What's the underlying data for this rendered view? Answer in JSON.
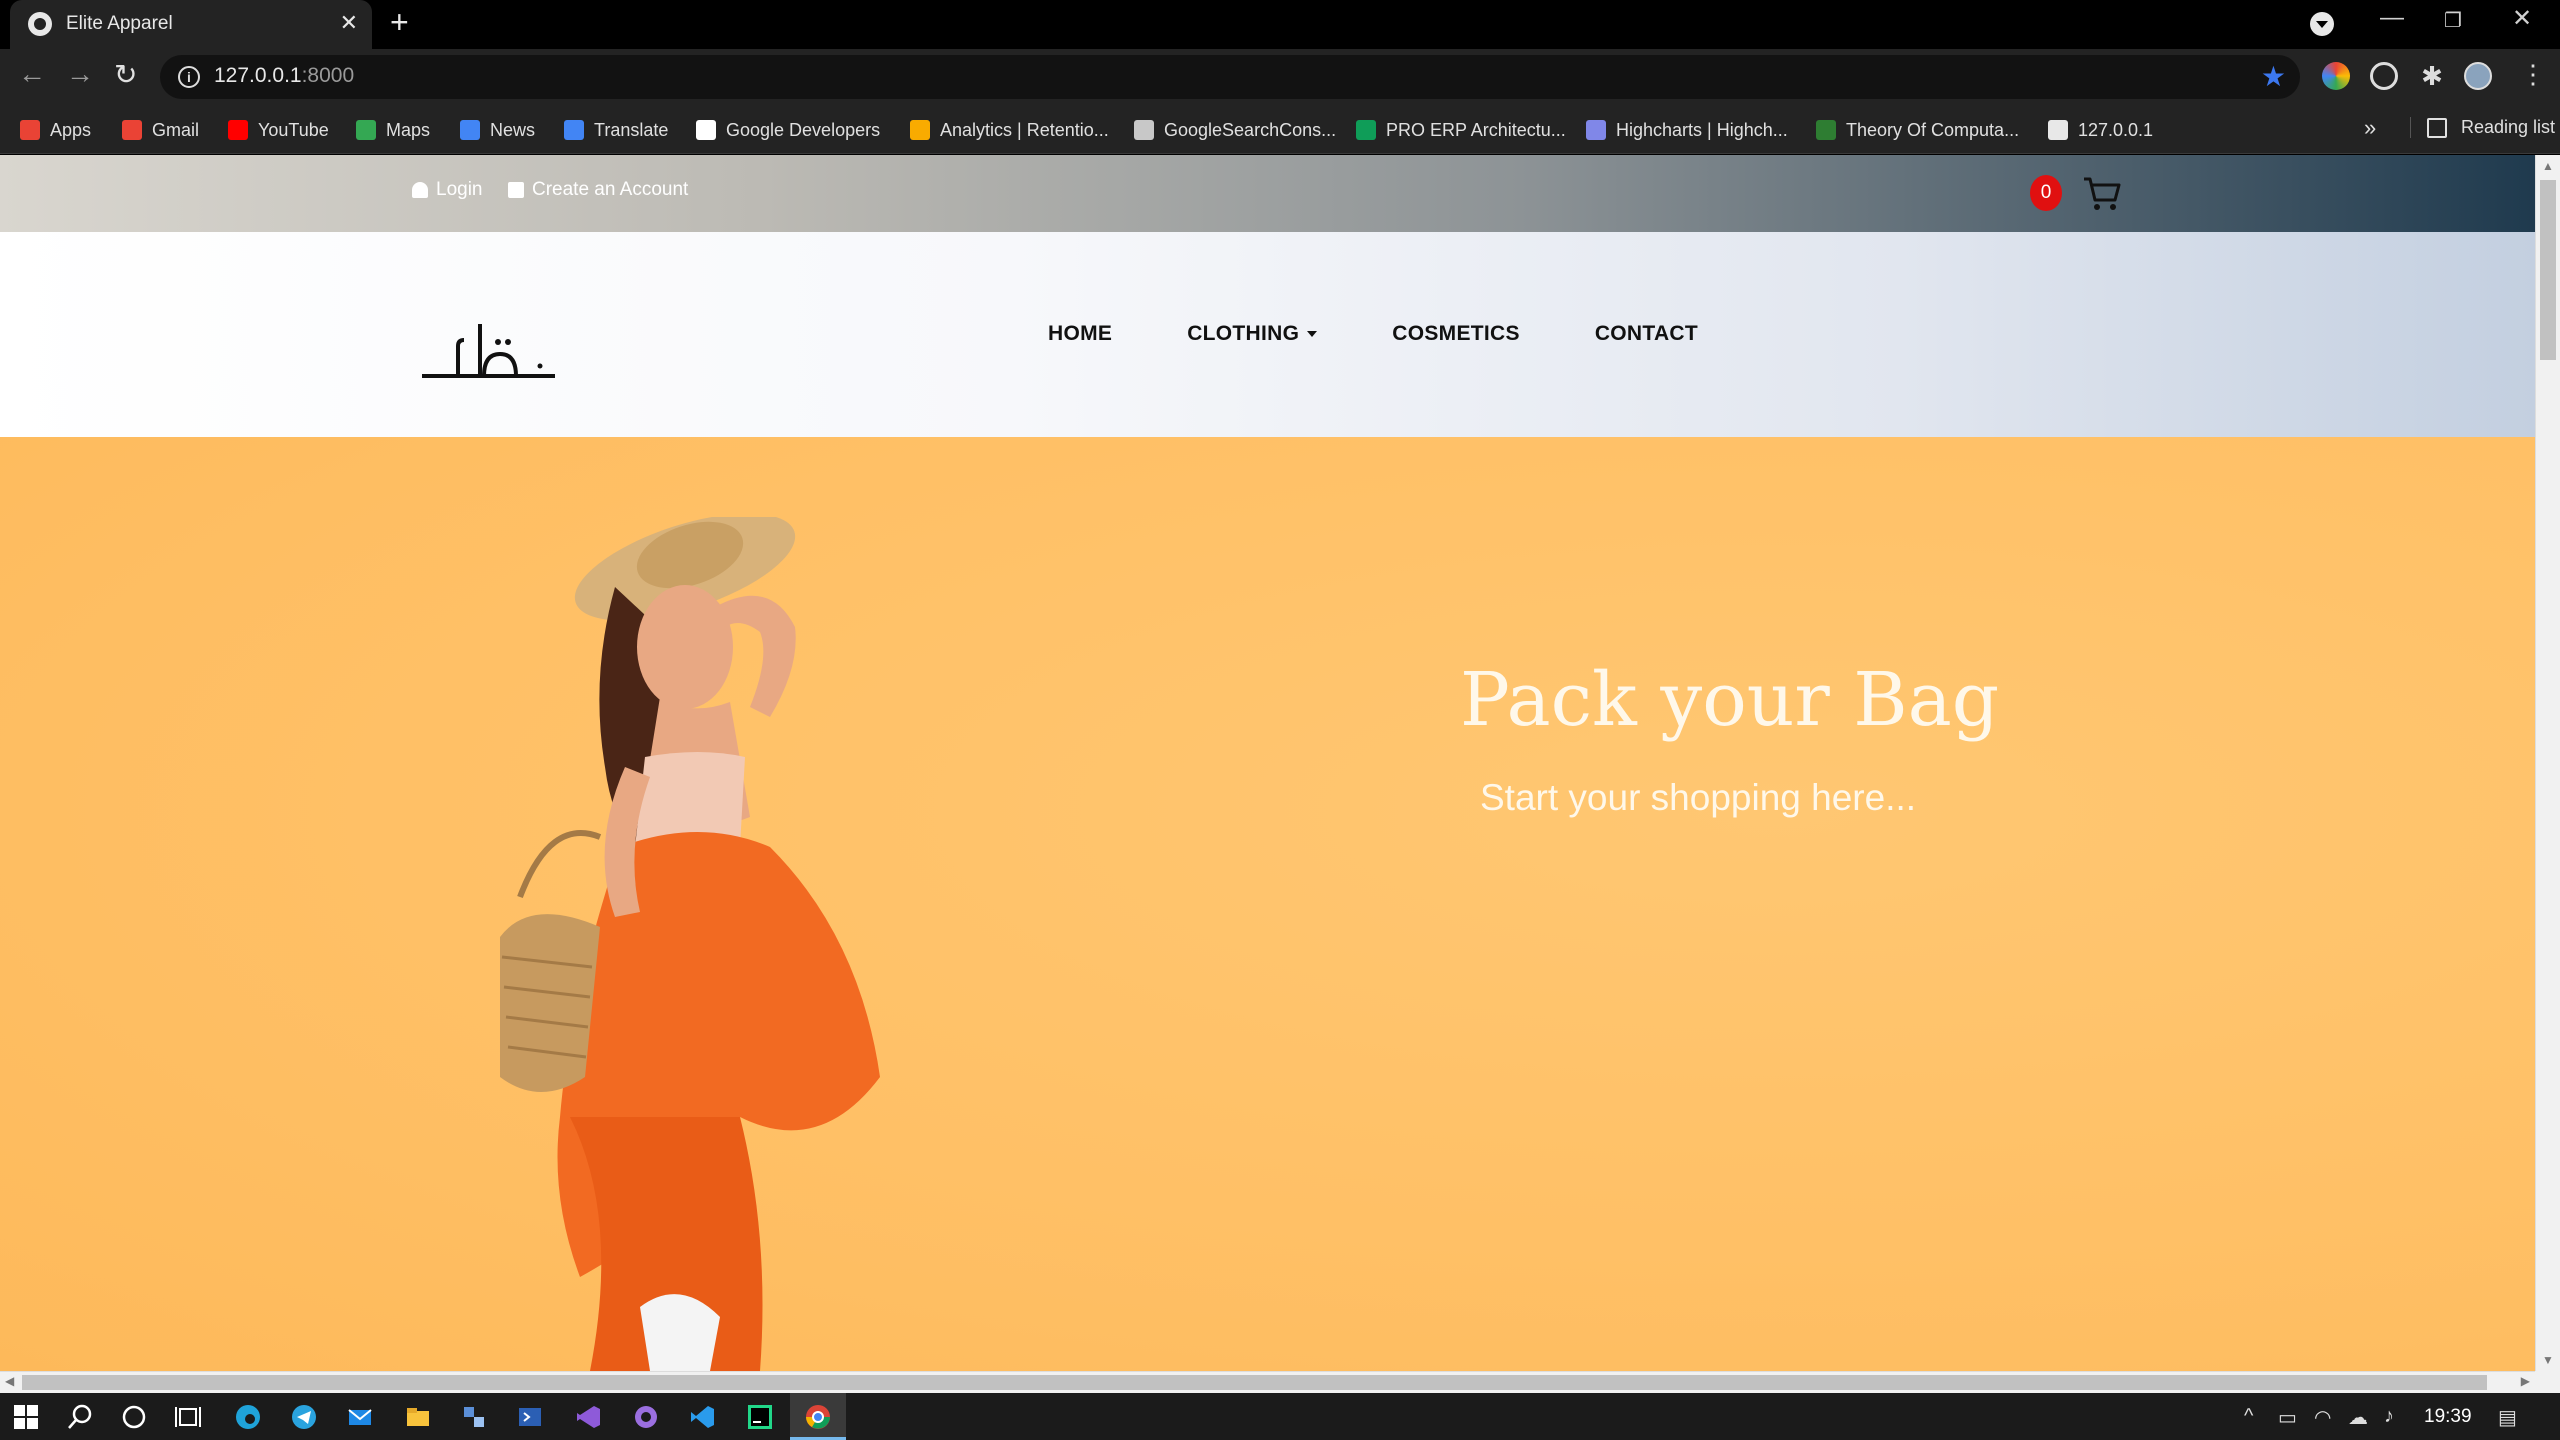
{
  "browser": {
    "tab_title": "Elite Apparel",
    "url_host": "127.0.0.1",
    "url_port": ":8000",
    "bookmarks": [
      {
        "label": "Apps",
        "color": "#e94335"
      },
      {
        "label": "Gmail",
        "color": "#ea4335"
      },
      {
        "label": "YouTube",
        "color": "#ff0000"
      },
      {
        "label": "Maps",
        "color": "#34a853"
      },
      {
        "label": "News",
        "color": "#4285f4"
      },
      {
        "label": "Translate",
        "color": "#4285f4"
      },
      {
        "label": "Google Developers",
        "color": "#ffffff"
      },
      {
        "label": "Analytics | Retentio...",
        "color": "#f9ab00"
      },
      {
        "label": "GoogleSearchCons...",
        "color": "#c8c8c8"
      },
      {
        "label": "PRO ERP Architectu...",
        "color": "#0f9d58"
      },
      {
        "label": "Highcharts | Highch...",
        "color": "#8087e8"
      },
      {
        "label": "Theory Of Computa...",
        "color": "#2e7d32"
      },
      {
        "label": "127.0.0.1",
        "color": "#e8e8e8"
      }
    ],
    "reading_list": "Reading list",
    "more_glyph": "»"
  },
  "site": {
    "topbar": {
      "login": "Login",
      "create_account": "Create an Account",
      "cart_count": "0"
    },
    "nav": {
      "home": "HOME",
      "clothing": "CLOTHING",
      "cosmetics": "COSMETICS",
      "contact": "CONTACT"
    },
    "logo_text": "NUQAT",
    "hero": {
      "title": "Pack your Bag",
      "subtitle": "Start your shopping here..."
    },
    "accent_color": "#ffc066",
    "badge_color": "#e01010"
  },
  "taskbar": {
    "clock": "19:39"
  }
}
